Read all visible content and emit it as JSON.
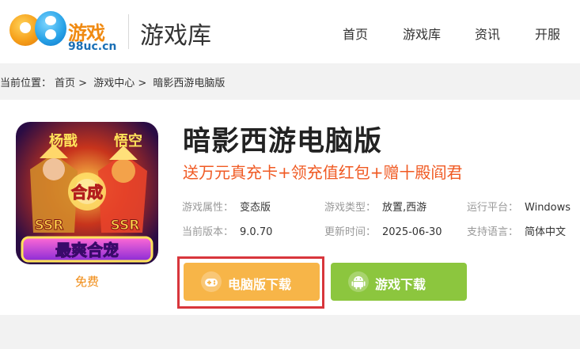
{
  "header": {
    "logo_text": "游戏",
    "logo_domain": "98uc.cn",
    "title": "游戏库",
    "nav": [
      "首页",
      "游戏库",
      "资讯",
      "开服"
    ]
  },
  "breadcrumb": {
    "prefix": "当前位置：",
    "items": [
      "首页",
      "游戏中心",
      "暗影西游电脑版"
    ],
    "separator": ">"
  },
  "game": {
    "title": "暗影西游电脑版",
    "promo": "送万元真充卡+领充值红包+赠十殿阎君",
    "icon_texts": [
      "杨戬",
      "悟空",
      "合成",
      "SSR",
      "SSR",
      "最爽合宠"
    ],
    "price": "免费",
    "attributes": [
      {
        "label": "游戏属性：",
        "value": "变态版"
      },
      {
        "label": "游戏类型：",
        "value": "放置,西游"
      },
      {
        "label": "运行平台：",
        "value": "Windows"
      },
      {
        "label": "当前版本：",
        "value": "9.0.70"
      },
      {
        "label": "更新时间：",
        "value": "2025-06-30"
      },
      {
        "label": "支持语言：",
        "value": "简体中文"
      }
    ],
    "buttons": {
      "pc_download": "电脑版下载",
      "game_download": "游戏下载"
    }
  },
  "colors": {
    "accent_orange": "#f7b548",
    "accent_green": "#8cc63e",
    "promo_red": "#f05a23",
    "highlight_red": "#d8363c"
  },
  "icons": [
    "gamepad-icon",
    "android-icon"
  ]
}
